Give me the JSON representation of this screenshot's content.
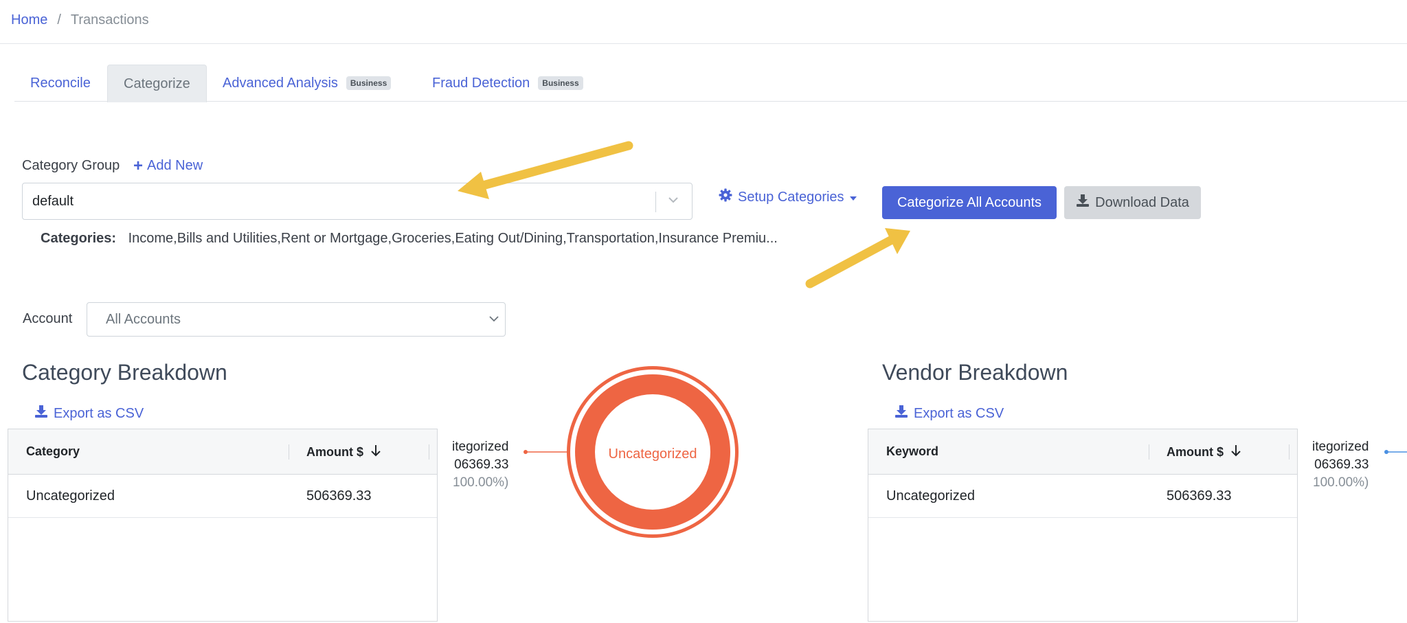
{
  "breadcrumb": {
    "home": "Home",
    "separator": "/",
    "current": "Transactions"
  },
  "tabs": [
    {
      "label": "Reconcile",
      "badge": ""
    },
    {
      "label": "Categorize",
      "badge": ""
    },
    {
      "label": "Advanced Analysis",
      "badge": "Business"
    },
    {
      "label": "Fraud Detection",
      "badge": "Business"
    }
  ],
  "active_tab": "Categorize",
  "category_group": {
    "label": "Category Group",
    "add_new": "Add New",
    "selected": "default",
    "categories_label": "Categories:",
    "categories_value": "Income,Bills and Utilities,Rent or Mortgage,Groceries,Eating Out/Dining,Transportation,Insurance Premiu..."
  },
  "actions": {
    "setup_categories": "Setup Categories",
    "categorize_all": "Categorize All Accounts",
    "download_data": "Download Data"
  },
  "account": {
    "label": "Account",
    "selected": "All Accounts"
  },
  "category_breakdown": {
    "title": "Category Breakdown",
    "export": "Export as CSV",
    "columns": [
      "Category",
      "Amount $"
    ],
    "rows": [
      {
        "name": "Uncategorized",
        "amount": "506369.33"
      }
    ],
    "pie_label": {
      "name": "itegorized",
      "value": "06369.33",
      "pct": "100.00%)"
    },
    "donut_center": "Uncategorized"
  },
  "vendor_breakdown": {
    "title": "Vendor Breakdown",
    "export": "Export as CSV",
    "columns": [
      "Keyword",
      "Amount $"
    ],
    "rows": [
      {
        "name": "Uncategorized",
        "amount": "506369.33"
      }
    ],
    "pie_label": {
      "name": "itegorized",
      "value": "06369.33",
      "pct": "100.00%)"
    }
  },
  "colors": {
    "accent": "#4a63d6",
    "donut": "#ee6543",
    "arrow": "#f0c143",
    "vendor_line": "#4a90e2"
  }
}
